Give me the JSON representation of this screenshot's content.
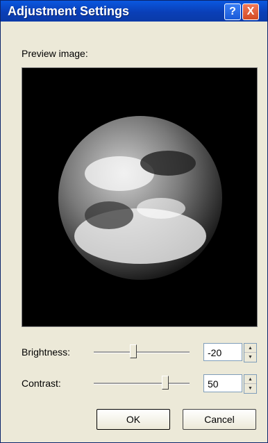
{
  "window": {
    "title": "Adjustment Settings",
    "help_symbol": "?",
    "close_symbol": "X"
  },
  "preview": {
    "label": "Preview image:"
  },
  "brightness": {
    "label": "Brightness:",
    "value": "-20",
    "slider_level": 0.4
  },
  "contrast": {
    "label": "Contrast:",
    "value": "50",
    "slider_level": 0.75
  },
  "buttons": {
    "ok": "OK",
    "cancel": "Cancel"
  },
  "colors": {
    "titlebar": "#0a3fb7",
    "dialog_bg": "#ece9d8",
    "preview_bg": "#000000"
  }
}
